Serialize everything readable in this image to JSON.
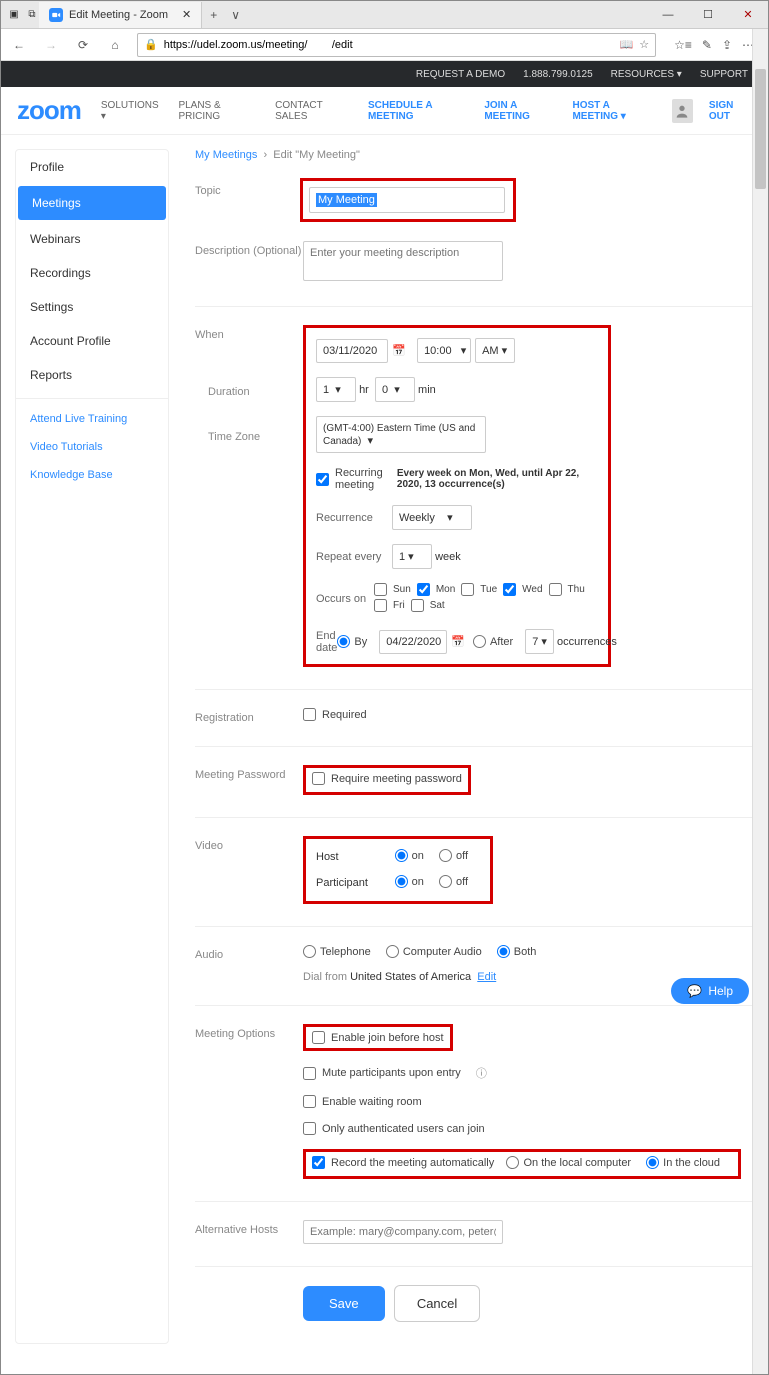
{
  "window": {
    "tab_title": "Edit Meeting - Zoom"
  },
  "url": "https://udel.zoom.us/meeting/        /edit",
  "topstrip": {
    "demo": "REQUEST A DEMO",
    "phone": "1.888.799.0125",
    "resources": "RESOURCES",
    "support": "SUPPORT"
  },
  "mainnav": {
    "logo": "zoom",
    "solutions": "SOLUTIONS",
    "plans": "PLANS & PRICING",
    "contact": "CONTACT SALES",
    "schedule": "SCHEDULE A MEETING",
    "join": "JOIN A MEETING",
    "host": "HOST A MEETING",
    "signout": "SIGN OUT"
  },
  "sidebar": {
    "items": [
      "Profile",
      "Meetings",
      "Webinars",
      "Recordings",
      "Settings",
      "Account Profile",
      "Reports"
    ],
    "links": [
      "Attend Live Training",
      "Video Tutorials",
      "Knowledge Base"
    ]
  },
  "breadcrumb": {
    "root": "My Meetings",
    "current": "Edit \"My Meeting\""
  },
  "labels": {
    "topic": "Topic",
    "description": "Description (Optional)",
    "when": "When",
    "duration": "Duration",
    "timezone": "Time Zone",
    "registration": "Registration",
    "password": "Meeting Password",
    "video": "Video",
    "audio": "Audio",
    "options": "Meeting Options",
    "althosts": "Alternative Hosts"
  },
  "topic": {
    "value": "My Meeting"
  },
  "description": {
    "placeholder": "Enter your meeting description"
  },
  "when": {
    "date": "03/11/2020",
    "time": "10:00",
    "ampm": "AM",
    "duration_hr": "1",
    "hr_lbl": "hr",
    "duration_min": "0",
    "min_lbl": "min",
    "tz": "(GMT-4:00) Eastern Time (US and Canada)",
    "recurring_lbl": "Recurring meeting",
    "recurring_summary": "Every week on Mon, Wed, until Apr 22, 2020, 13 occurrence(s)",
    "recurrence_lbl": "Recurrence",
    "recurrence_val": "Weekly",
    "repeat_lbl": "Repeat every",
    "repeat_val": "1",
    "repeat_unit": "week",
    "occurs_lbl": "Occurs on",
    "days": [
      "Sun",
      "Mon",
      "Tue",
      "Wed",
      "Thu",
      "Fri",
      "Sat"
    ],
    "days_checked": [
      false,
      true,
      false,
      true,
      false,
      false,
      false
    ],
    "enddate_lbl": "End date",
    "by_lbl": "By",
    "by_date": "04/22/2020",
    "after_lbl": "After",
    "after_val": "7",
    "after_unit": "occurrences"
  },
  "registration": {
    "required_lbl": "Required"
  },
  "password": {
    "require_lbl": "Require meeting password"
  },
  "video": {
    "host_lbl": "Host",
    "part_lbl": "Participant",
    "on": "on",
    "off": "off"
  },
  "audio": {
    "tel": "Telephone",
    "comp": "Computer Audio",
    "both": "Both",
    "dial_lbl": "Dial from",
    "dial_country": "United States of America",
    "edit": "Edit"
  },
  "options": {
    "join": "Enable join before host",
    "mute": "Mute participants upon entry",
    "waiting": "Enable waiting room",
    "auth": "Only authenticated users can join",
    "record": "Record the meeting automatically",
    "local": "On the local computer",
    "cloud": "In the cloud"
  },
  "althosts": {
    "placeholder": "Example: mary@company.com, peter@school.edu"
  },
  "buttons": {
    "save": "Save",
    "cancel": "Cancel"
  },
  "help": "Help"
}
